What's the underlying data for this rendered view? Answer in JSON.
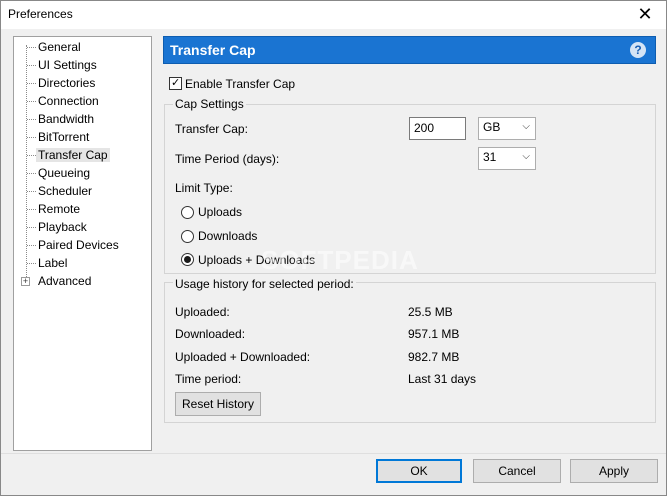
{
  "window": {
    "title": "Preferences",
    "close_glyph": "✕"
  },
  "sidebar": {
    "items": [
      {
        "label": "General"
      },
      {
        "label": "UI Settings"
      },
      {
        "label": "Directories"
      },
      {
        "label": "Connection"
      },
      {
        "label": "Bandwidth"
      },
      {
        "label": "BitTorrent"
      },
      {
        "label": "Transfer Cap",
        "selected": true
      },
      {
        "label": "Queueing"
      },
      {
        "label": "Scheduler"
      },
      {
        "label": "Remote"
      },
      {
        "label": "Playback"
      },
      {
        "label": "Paired Devices"
      },
      {
        "label": "Label"
      },
      {
        "label": "Advanced",
        "expandable": true
      }
    ],
    "expander_glyph": "+"
  },
  "panel": {
    "title": "Transfer Cap",
    "help_glyph": "?",
    "enable_label": "Enable Transfer Cap",
    "enable_checked": true,
    "check_glyph": "✓"
  },
  "cap_settings": {
    "legend": "Cap Settings",
    "transfer_cap_label": "Transfer Cap:",
    "transfer_cap_value": "200",
    "unit_value": "GB",
    "time_period_label": "Time Period (days):",
    "time_period_value": "31",
    "limit_type_label": "Limit Type:",
    "options": [
      {
        "label": "Uploads",
        "selected": false
      },
      {
        "label": "Downloads",
        "selected": false
      },
      {
        "label": "Uploads + Downloads",
        "selected": true
      }
    ],
    "dropdown_glyph": "⌵"
  },
  "usage": {
    "legend": "Usage history for selected period:",
    "rows": [
      {
        "label": "Uploaded:",
        "value": "25.5 MB"
      },
      {
        "label": "Downloaded:",
        "value": "957.1 MB"
      },
      {
        "label": "Uploaded + Downloaded:",
        "value": "982.7 MB"
      },
      {
        "label": "Time period:",
        "value": "Last 31 days"
      }
    ],
    "reset_label": "Reset History"
  },
  "footer": {
    "ok": "OK",
    "cancel": "Cancel",
    "apply": "Apply"
  },
  "watermark": "SOFTPEDIA",
  "colors": {
    "header": "#1a74d2",
    "default_button_border": "#0078d7"
  }
}
